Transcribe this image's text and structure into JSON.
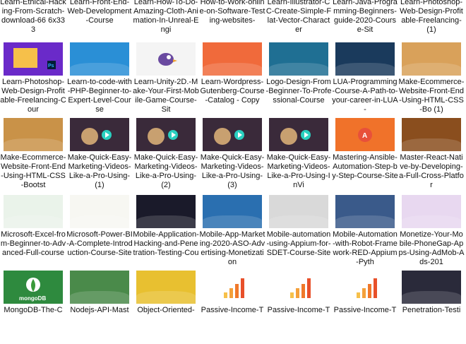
{
  "top_row_labels": [
    "Learn-Ethical-Hacking-From-Scratch-download-66 6x333",
    "Learn-Front-End-Web-Development-Course",
    "Learn-How-To-Do-Amazing-Cloth-Animation-In-Unreal-Engi",
    "How-to-Work-online-on-Software-Testing-websites-",
    "Learn-Illustrator-CC-Create-Simple-Flat-Vector-Character",
    "Learn-Java-Programming-Beginners-guide-2020-Course-Sit",
    "Learn-Photoshop-Web-Design-Profitable-Freelancing- (1)"
  ],
  "rows": [
    [
      {
        "label": "Learn-Photoshop-Web-Design-Profitable-Freelancing-Cour",
        "icon": "photoshop-thumb",
        "bg": "#6a2ac9"
      },
      {
        "label": "Learn-to-code-with-PHP-Beginner-to-Expert-Level-Course",
        "icon": "php-thumb",
        "bg": "#2a8fd6"
      },
      {
        "label": "Learn-Unity-2D.-Make-Your-First-Mobile-Game-Course-Sit",
        "icon": "flappy-bird-thumb",
        "bg": "#f4f4f4"
      },
      {
        "label": "Learn-Wordpress-Gutenberg-Course-Catalog - Copy",
        "icon": "wordpress-thumb",
        "bg": "#f06a3b"
      },
      {
        "label": "Logo-Design-From-Beginner-To-Professional-Course",
        "icon": "logo-design-thumb",
        "bg": "#1f6f93"
      },
      {
        "label": "LUA-Programming-Course-A-Path-to-your-career-in-LUA-",
        "icon": "lua-thumb",
        "bg": "#1a3a5c"
      },
      {
        "label": "Make-Ecommerce-Website-Front-End-Using-HTML-CSS-Bo (1)",
        "icon": "ecommerce-thumb",
        "bg": "#d9a15a"
      }
    ],
    [
      {
        "label": "Make-Ecommerce-Website-Front-End-Using-HTML-CSS-Bootst",
        "icon": "ecommerce-thumb",
        "bg": "#c99248"
      },
      {
        "label": "Make-Quick-Easy-Marketing-Videos-Like-a-Pro-Using- (1)",
        "icon": "video-thumb",
        "bg": "#3a2a3a"
      },
      {
        "label": "Make-Quick-Easy-Marketing-Videos-Like-a-Pro-Using- (2)",
        "icon": "video-thumb",
        "bg": "#3a2a3a"
      },
      {
        "label": "Make-Quick-Easy-Marketing-Videos-Like-a-Pro-Using- (3)",
        "icon": "video-thumb",
        "bg": "#3a2a3a"
      },
      {
        "label": "Make-Quick-Easy-Marketing-Videos-Like-a-Pro-Using-InVi",
        "icon": "video-thumb",
        "bg": "#3a2a3a"
      },
      {
        "label": "Mastering-Ansible-Automation-Step-by-Step-Course-Site",
        "icon": "ansible-thumb",
        "bg": "#f0722a"
      },
      {
        "label": "Master-React-Native-by-Developing-a-Full-Cross-Platfor",
        "icon": "react-native-thumb",
        "bg": "#8a4e1e"
      }
    ],
    [
      {
        "label": "Microsoft-Excel-from-Beginner-to-Advanced-Full-course",
        "icon": "excel-thumb",
        "bg": "#eaf3ea"
      },
      {
        "label": "Microsoft-Power-BI-A-Complete-Introduction-Course-Site",
        "icon": "powerbi-thumb",
        "bg": "#f7f7f2"
      },
      {
        "label": "Mobile-Application-Hacking-and-Penetration-Testing-Cou",
        "icon": "hacking-thumb",
        "bg": "#1a1a2a"
      },
      {
        "label": "Mobile-App-Marketing-2020-ASO-Advertising-Monetization",
        "icon": "app-marketing-thumb",
        "bg": "#2a6fb0"
      },
      {
        "label": "Mobile-automation-using-Appium-for-SDET-Course-Site",
        "icon": "appium-thumb",
        "bg": "#d9d9d9"
      },
      {
        "label": "Mobile-Automation-with-Robot-Framework-RED-Appium-Pyth",
        "icon": "robot-framework-thumb",
        "bg": "#3a5a8a"
      },
      {
        "label": "Monetize-Your-Mobile-PhoneGap-Apps-Using-AdMob-Ads-201",
        "icon": "phonegap-thumb",
        "bg": "#e8d8f0"
      }
    ],
    [
      {
        "label": "MongoDB-The-C",
        "icon": "mongodb-thumb",
        "bg": "#2e8a3e"
      },
      {
        "label": "Nodejs-API-Mast",
        "icon": "nodejs-api-thumb",
        "bg": "#4a8a4a"
      },
      {
        "label": "Object-Oriented-",
        "icon": "oop-thumb",
        "bg": "#e8c030"
      },
      {
        "label": "Passive-Income-T",
        "icon": "passive-income-thumb",
        "bg": "#ffffff"
      },
      {
        "label": "Passive-Income-T",
        "icon": "passive-income-thumb",
        "bg": "#ffffff"
      },
      {
        "label": "Passive-Income-T",
        "icon": "passive-income-thumb",
        "bg": "#ffffff"
      },
      {
        "label": "Penetration-Testi",
        "icon": "pentest-thumb",
        "bg": "#2a2a3a"
      }
    ]
  ]
}
